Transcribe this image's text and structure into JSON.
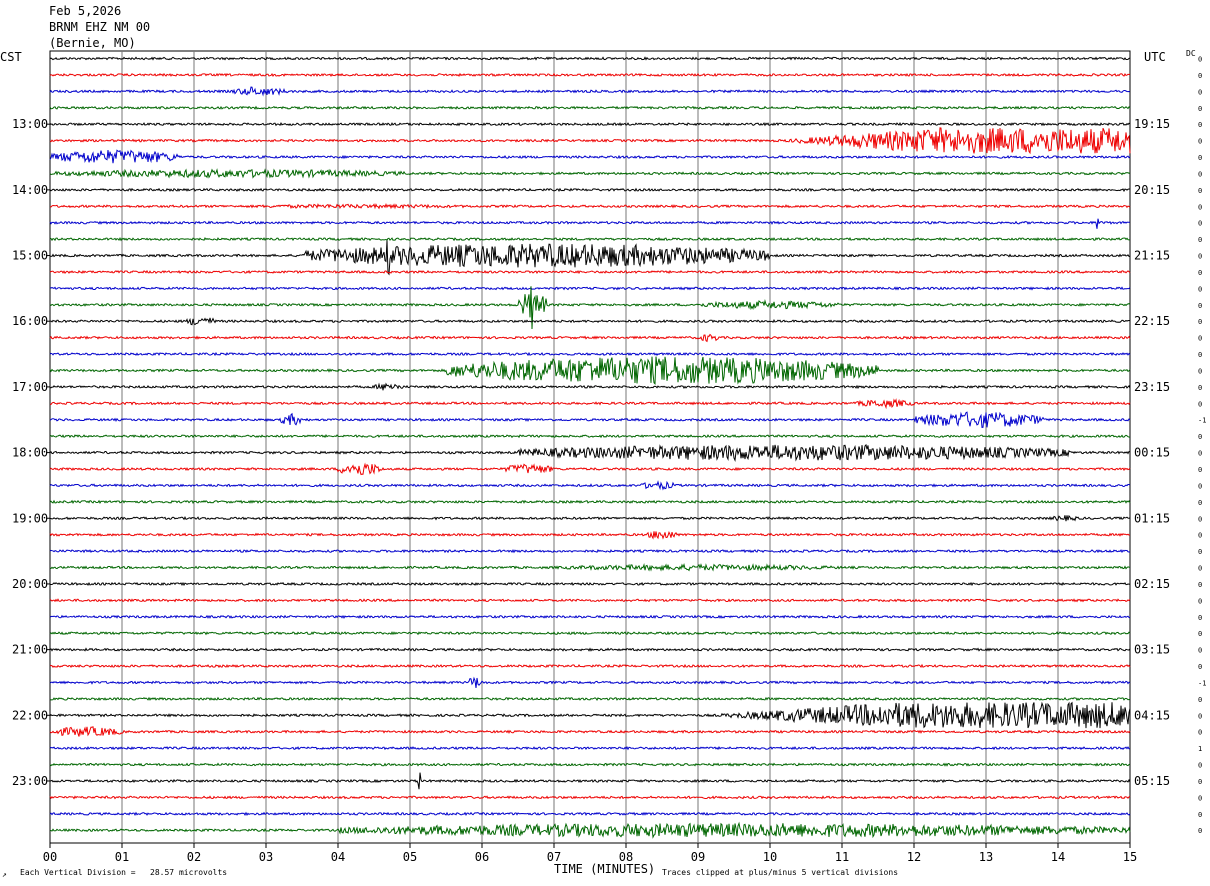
{
  "header": {
    "date": "Feb 5,2026",
    "station": "BRNM EHZ NM 00",
    "location": "(Bernie, MO)"
  },
  "left_zone_label": "CST",
  "right_zone_label": "UTC",
  "dc_label": "DC",
  "footer": {
    "vertical_division": "Each Vertical Division =   28.57 microvolts",
    "clipping_note": "Traces clipped at plus/minus 5 vertical divisions",
    "corner_mark": "↗"
  },
  "chart_data": {
    "type": "line",
    "xlabel": "TIME (MINUTES)",
    "x_ticks": [
      "00",
      "01",
      "02",
      "03",
      "04",
      "05",
      "06",
      "07",
      "08",
      "09",
      "10",
      "11",
      "12",
      "13",
      "14",
      "15"
    ],
    "xlim": [
      0,
      15
    ],
    "grid": true,
    "trace_count": 48,
    "trace_colors": [
      "#000000",
      "#ee0000",
      "#0000cc",
      "#006600"
    ],
    "cst_hour_labels": [
      {
        "row": 4,
        "label": "13:00"
      },
      {
        "row": 8,
        "label": "14:00"
      },
      {
        "row": 12,
        "label": "15:00"
      },
      {
        "row": 16,
        "label": "16:00"
      },
      {
        "row": 20,
        "label": "17:00"
      },
      {
        "row": 24,
        "label": "18:00"
      },
      {
        "row": 28,
        "label": "19:00"
      },
      {
        "row": 32,
        "label": "20:00"
      },
      {
        "row": 36,
        "label": "21:00"
      },
      {
        "row": 40,
        "label": "22:00"
      },
      {
        "row": 44,
        "label": "23:00"
      }
    ],
    "utc_hour_labels": [
      {
        "row": 4,
        "label": "19:15"
      },
      {
        "row": 8,
        "label": "20:15"
      },
      {
        "row": 12,
        "label": "21:15"
      },
      {
        "row": 16,
        "label": "22:15"
      },
      {
        "row": 20,
        "label": "23:15"
      },
      {
        "row": 24,
        "label": "00:15"
      },
      {
        "row": 28,
        "label": "01:15"
      },
      {
        "row": 32,
        "label": "02:15"
      },
      {
        "row": 36,
        "label": "03:15"
      },
      {
        "row": 40,
        "label": "04:15"
      },
      {
        "row": 44,
        "label": "05:15"
      }
    ],
    "dc_offsets": [
      "0",
      "0",
      "0",
      "0",
      "0",
      "0",
      "0",
      "0",
      "0",
      "0",
      "0",
      "0",
      "0",
      "0",
      "0",
      "0",
      "0",
      "0",
      "0",
      "0",
      "0",
      "0",
      "-1",
      "0",
      "0",
      "0",
      "0",
      "0",
      "0",
      "0",
      "0",
      "0",
      "0",
      "0",
      "0",
      "0",
      "0",
      "0",
      "-1",
      "0",
      "0",
      "0",
      "1",
      "0",
      "0",
      "0",
      "0",
      "0",
      "0"
    ],
    "events": [
      {
        "row": 2,
        "start_min": 2.5,
        "end_min": 3.3,
        "amp": 4,
        "spike_at": 2.8,
        "spike": 5
      },
      {
        "row": 5,
        "start_min": 10.0,
        "end_min": 15,
        "amp": 13,
        "ramp": true
      },
      {
        "row": 6,
        "start_min": 0,
        "end_min": 1.8,
        "amp": 7
      },
      {
        "row": 7,
        "start_min": 0,
        "end_min": 5.0,
        "amp": 4
      },
      {
        "row": 9,
        "start_min": 2.5,
        "end_min": 6.0,
        "amp": 2
      },
      {
        "row": 10,
        "start_min": 14.5,
        "end_min": 14.7,
        "amp": 2,
        "spike_at": 14.55,
        "spike": 8
      },
      {
        "row": 12,
        "start_min": 3.5,
        "end_min": 10.0,
        "amp": 12,
        "spike_at": 4.7,
        "spike": 20
      },
      {
        "row": 15,
        "start_min": 6.5,
        "end_min": 6.9,
        "amp": 14,
        "spike_at": 6.7,
        "spike": 25
      },
      {
        "row": 15,
        "start_min": 9.0,
        "end_min": 11.0,
        "amp": 4
      },
      {
        "row": 16,
        "start_min": 1.9,
        "end_min": 2.3,
        "amp": 5
      },
      {
        "row": 17,
        "start_min": 9.0,
        "end_min": 9.3,
        "amp": 4
      },
      {
        "row": 19,
        "start_min": 5.5,
        "end_min": 11.5,
        "amp": 14
      },
      {
        "row": 20,
        "start_min": 4.5,
        "end_min": 4.9,
        "amp": 4
      },
      {
        "row": 21,
        "start_min": 11.2,
        "end_min": 12.0,
        "amp": 4
      },
      {
        "row": 22,
        "start_min": 3.2,
        "end_min": 3.5,
        "amp": 6
      },
      {
        "row": 22,
        "start_min": 12.0,
        "end_min": 13.8,
        "amp": 8
      },
      {
        "row": 24,
        "start_min": 6.5,
        "end_min": 14.2,
        "amp": 8
      },
      {
        "row": 25,
        "start_min": 4.0,
        "end_min": 4.6,
        "amp": 7
      },
      {
        "row": 25,
        "start_min": 6.3,
        "end_min": 7.0,
        "amp": 5
      },
      {
        "row": 26,
        "start_min": 8.2,
        "end_min": 8.7,
        "amp": 4
      },
      {
        "row": 28,
        "start_min": 13.9,
        "end_min": 14.3,
        "amp": 3
      },
      {
        "row": 29,
        "start_min": 8.3,
        "end_min": 8.7,
        "amp": 5
      },
      {
        "row": 31,
        "start_min": 7.0,
        "end_min": 11.0,
        "amp": 3
      },
      {
        "row": 38,
        "start_min": 5.8,
        "end_min": 6.0,
        "amp": 6
      },
      {
        "row": 40,
        "start_min": 9.0,
        "end_min": 15,
        "amp": 13,
        "ramp": true
      },
      {
        "row": 41,
        "start_min": 0,
        "end_min": 1.0,
        "amp": 5
      },
      {
        "row": 44,
        "start_min": 5.1,
        "end_min": 5.15,
        "amp": 2,
        "spike_at": 5.12,
        "spike": 11
      },
      {
        "row": 47,
        "start_min": 4.0,
        "end_min": 15,
        "amp": 7
      }
    ]
  }
}
